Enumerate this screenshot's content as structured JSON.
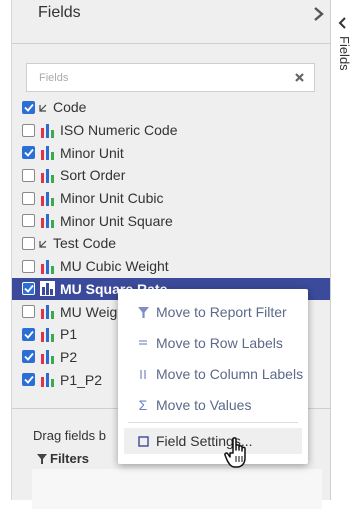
{
  "panel": {
    "title": "Fields",
    "side_tab_label": "Fields",
    "search_placeholder": "Fields"
  },
  "fields": [
    {
      "label": "Code",
      "checked": true,
      "icon": "dimension-icon"
    },
    {
      "label": "ISO Numeric Code",
      "checked": false,
      "icon": "measure-icon"
    },
    {
      "label": "Minor Unit",
      "checked": true,
      "icon": "measure-icon"
    },
    {
      "label": "Sort Order",
      "checked": false,
      "icon": "measure-icon"
    },
    {
      "label": "Minor Unit Cubic",
      "checked": false,
      "icon": "measure-icon"
    },
    {
      "label": "Minor Unit Square",
      "checked": false,
      "icon": "measure-icon"
    },
    {
      "label": "Test Code",
      "checked": false,
      "icon": "dimension-icon"
    },
    {
      "label": "MU Cubic Weight",
      "checked": false,
      "icon": "measure-icon"
    },
    {
      "label": "MU Square Rate",
      "checked": true,
      "icon": "measure-icon",
      "selected": true
    },
    {
      "label": "MU Weig",
      "checked": false,
      "icon": "measure-icon"
    },
    {
      "label": "P1",
      "checked": true,
      "icon": "measure-icon"
    },
    {
      "label": "P2",
      "checked": true,
      "icon": "measure-icon"
    },
    {
      "label": "P1_P2",
      "checked": true,
      "icon": "measure-icon"
    }
  ],
  "bottom": {
    "drag_text": "Drag fields b",
    "filters_label": "Filters"
  },
  "context_menu": {
    "move_report_filter": "Move to Report Filter",
    "move_row_labels": "Move to Row Labels",
    "move_column_labels": "Move to Column Labels",
    "move_values": "Move to Values",
    "field_settings": "Field Settings..."
  },
  "colors": {
    "selected_row": "#3b4a9a",
    "checkbox_checked": "#2b6fd6",
    "menu_icon": "#6b7fc0"
  }
}
